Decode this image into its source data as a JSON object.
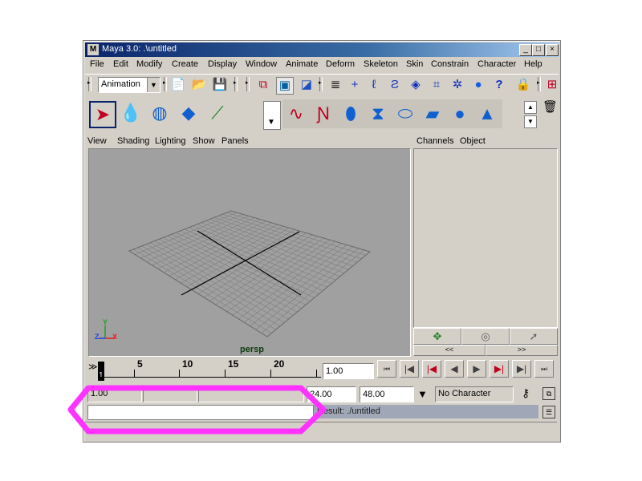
{
  "window": {
    "title": "Maya 3.0: .\\untitled",
    "logo": "M",
    "minimize": "_",
    "maximize": "□",
    "close": "×"
  },
  "menus": [
    "File",
    "Edit",
    "Modify",
    "Create",
    "Display",
    "Window",
    "Animate",
    "Deform",
    "Skeleton",
    "Skin",
    "Constrain",
    "Character",
    "Help"
  ],
  "status_line": {
    "menu_set": "Animation",
    "icons": [
      "new-scene-icon",
      "open-scene-icon",
      "save-scene-icon",
      "select-hierarchy-icon",
      "select-object-icon",
      "select-component-icon",
      "mask-menu-icon",
      "snap-grid-icon",
      "snap-curve-icon",
      "snap-point-icon",
      "snap-plane-icon",
      "history-icon",
      "render-icon",
      "ipr-icon",
      "help-icon",
      "lock-icon",
      "input-output-icon"
    ]
  },
  "shelf": {
    "tool_icons": [
      "select-tool-icon",
      "lasso-tool-icon",
      "rotate-tool-icon",
      "scale-tool-icon",
      "show-manipulator-icon"
    ],
    "shelf_icons": [
      "curve-cv-icon",
      "curve-ep-icon",
      "nurbs-loft-icon",
      "nurbs-revolve-icon",
      "nurbs-extrude-icon",
      "nurbs-plane-icon",
      "nurbs-sphere-icon",
      "nurbs-cone-icon"
    ],
    "arrow_up": "▲",
    "arrow_down": "▼",
    "trash": "🗑"
  },
  "viewport": {
    "menu": [
      "View",
      "Shading",
      "Lighting",
      "Show",
      "Panels"
    ],
    "camera_label": "persp",
    "axis_x": "X",
    "axis_y": "Y",
    "axis_z": "Z"
  },
  "channel_box": {
    "menu": [
      "Channels",
      "Object"
    ],
    "scroll_left": "<<",
    "scroll_right": ">>"
  },
  "timeline": {
    "ticks": [
      "5",
      "10",
      "15",
      "20"
    ],
    "current_frame": "1",
    "current_time": "1.00",
    "playback_buttons": [
      "⏮",
      "|◀",
      "|◀",
      "◀",
      "▶",
      "▶|",
      "▶|",
      "⏭"
    ]
  },
  "range": {
    "start": "1.00",
    "end": "24.00",
    "anim_end": "48.00",
    "character": "No Character"
  },
  "command_line": {
    "input_value": "",
    "result": "Result: ./untitled"
  },
  "colors": {
    "highlight": "#ff33ff",
    "viewport_bg": "#a0a0a0",
    "title_start": "#0a246a"
  }
}
